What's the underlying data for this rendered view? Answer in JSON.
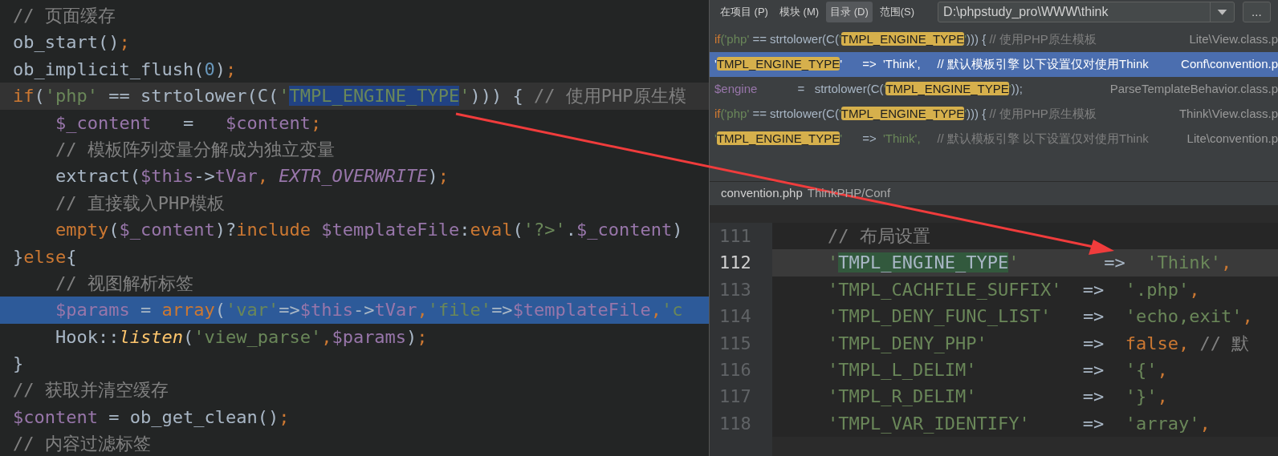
{
  "editor": {
    "lines": [
      {
        "caret_line": false,
        "selected": false,
        "tokens": [
          {
            "kind": "comment",
            "text": "// 页面缓存"
          }
        ]
      },
      {
        "caret_line": false,
        "selected": false,
        "tokens": [
          {
            "kind": "plain",
            "text": "ob_start()"
          },
          {
            "kind": "keyword",
            "text": ";"
          }
        ]
      },
      {
        "caret_line": false,
        "selected": false,
        "tokens": [
          {
            "kind": "plain",
            "text": "ob_implicit_flush("
          },
          {
            "kind": "number",
            "text": "0"
          },
          {
            "kind": "plain",
            "text": ")"
          },
          {
            "kind": "keyword",
            "text": ";"
          }
        ]
      },
      {
        "caret_line": true,
        "selected": false,
        "tokens": [
          {
            "kind": "keyword",
            "text": "if"
          },
          {
            "kind": "plain",
            "text": "("
          },
          {
            "kind": "string",
            "text": "'php'"
          },
          {
            "kind": "plain",
            "text": " == strtolower(C("
          },
          {
            "kind": "string",
            "text": "'"
          },
          {
            "kind": "string-selected",
            "text": "TMPL_ENGINE_TYPE"
          },
          {
            "kind": "string",
            "text": "'"
          },
          {
            "kind": "plain",
            "text": "))) { "
          },
          {
            "kind": "comment",
            "text": "// 使用PHP原生模"
          }
        ]
      },
      {
        "caret_line": false,
        "selected": false,
        "tokens": [
          {
            "kind": "var",
            "text": "    $_content"
          },
          {
            "kind": "plain",
            "text": "   =   "
          },
          {
            "kind": "var",
            "text": "$content"
          },
          {
            "kind": "keyword",
            "text": ";"
          }
        ]
      },
      {
        "caret_line": false,
        "selected": false,
        "tokens": [
          {
            "kind": "comment",
            "text": "    // 模板阵列变量分解成为独立变量"
          }
        ]
      },
      {
        "caret_line": false,
        "selected": false,
        "tokens": [
          {
            "kind": "plain",
            "text": "    extract("
          },
          {
            "kind": "var",
            "text": "$this"
          },
          {
            "kind": "plain",
            "text": "->"
          },
          {
            "kind": "var",
            "text": "tVar"
          },
          {
            "kind": "keyword",
            "text": ", "
          },
          {
            "kind": "constant",
            "text": "EXTR_OVERWRITE"
          },
          {
            "kind": "plain",
            "text": ")"
          },
          {
            "kind": "keyword",
            "text": ";"
          }
        ]
      },
      {
        "caret_line": false,
        "selected": false,
        "tokens": [
          {
            "kind": "comment",
            "text": "    // 直接载入PHP模板"
          }
        ]
      },
      {
        "caret_line": false,
        "selected": false,
        "tokens": [
          {
            "kind": "keyword",
            "text": "    empty"
          },
          {
            "kind": "plain",
            "text": "("
          },
          {
            "kind": "var",
            "text": "$_content"
          },
          {
            "kind": "plain",
            "text": ")?"
          },
          {
            "kind": "keyword",
            "text": "include "
          },
          {
            "kind": "var",
            "text": "$templateFile"
          },
          {
            "kind": "plain",
            "text": ":"
          },
          {
            "kind": "keyword",
            "text": "eval"
          },
          {
            "kind": "plain",
            "text": "("
          },
          {
            "kind": "string",
            "text": "'?>'"
          },
          {
            "kind": "plain",
            "text": "."
          },
          {
            "kind": "var",
            "text": "$_content"
          },
          {
            "kind": "plain",
            "text": ")"
          }
        ]
      },
      {
        "caret_line": false,
        "selected": false,
        "tokens": [
          {
            "kind": "plain",
            "text": "}"
          },
          {
            "kind": "keyword",
            "text": "else"
          },
          {
            "kind": "plain",
            "text": "{"
          }
        ]
      },
      {
        "caret_line": false,
        "selected": false,
        "tokens": [
          {
            "kind": "comment",
            "text": "    // 视图解析标签"
          }
        ]
      },
      {
        "caret_line": false,
        "selected": true,
        "tokens": [
          {
            "kind": "var",
            "text": "    $params"
          },
          {
            "kind": "plain",
            "text": " = "
          },
          {
            "kind": "keyword",
            "text": "array"
          },
          {
            "kind": "plain",
            "text": "("
          },
          {
            "kind": "string",
            "text": "'var'"
          },
          {
            "kind": "plain",
            "text": "=>"
          },
          {
            "kind": "var",
            "text": "$this"
          },
          {
            "kind": "plain",
            "text": "->"
          },
          {
            "kind": "var",
            "text": "tVar"
          },
          {
            "kind": "keyword",
            "text": ","
          },
          {
            "kind": "string",
            "text": "'file'"
          },
          {
            "kind": "plain",
            "text": "=>"
          },
          {
            "kind": "var",
            "text": "$templateFile"
          },
          {
            "kind": "keyword",
            "text": ","
          },
          {
            "kind": "string",
            "text": "'c"
          }
        ]
      },
      {
        "caret_line": false,
        "selected": false,
        "tokens": [
          {
            "kind": "plain",
            "text": "    Hook::"
          },
          {
            "kind": "static",
            "text": "listen"
          },
          {
            "kind": "plain",
            "text": "("
          },
          {
            "kind": "string",
            "text": "'view_parse'"
          },
          {
            "kind": "keyword",
            "text": ","
          },
          {
            "kind": "var",
            "text": "$params"
          },
          {
            "kind": "plain",
            "text": ")"
          },
          {
            "kind": "keyword",
            "text": ";"
          }
        ]
      },
      {
        "caret_line": false,
        "selected": false,
        "tokens": [
          {
            "kind": "plain",
            "text": "}"
          }
        ]
      },
      {
        "caret_line": false,
        "selected": false,
        "tokens": [
          {
            "kind": "comment",
            "text": "// 获取并清空缓存"
          }
        ]
      },
      {
        "caret_line": false,
        "selected": false,
        "tokens": [
          {
            "kind": "var",
            "text": "$content"
          },
          {
            "kind": "plain",
            "text": " = ob_get_clean()"
          },
          {
            "kind": "keyword",
            "text": ";"
          }
        ]
      },
      {
        "caret_line": false,
        "selected": false,
        "tokens": [
          {
            "kind": "comment",
            "text": "// 内容过滤标签"
          }
        ]
      }
    ]
  },
  "find_popup": {
    "scopes": [
      {
        "label": "在项目 (P)",
        "selected": false
      },
      {
        "label": "模块 (M)",
        "selected": false
      },
      {
        "label": "目录 (D)",
        "selected": true
      },
      {
        "label": "范围(S)",
        "selected": false
      }
    ],
    "directory": {
      "value": "D:\\phpstudy_pro\\WWW\\think"
    },
    "browse_button": "...",
    "results": [
      {
        "selected": false,
        "segments": [
          {
            "kind": "keyword",
            "text": "if"
          },
          {
            "kind": "string",
            "text": "('php'"
          },
          {
            "kind": "plain",
            "text": " == strtolower(C("
          },
          {
            "kind": "string",
            "text": "'"
          },
          {
            "kind": "match",
            "text": "TMPL_ENGINE_TYPE"
          },
          {
            "kind": "string",
            "text": "'"
          },
          {
            "kind": "plain",
            "text": "))) { "
          },
          {
            "kind": "comment",
            "text": "// 使用PHP原生模板"
          }
        ],
        "file": "Lite\\View.class.p"
      },
      {
        "selected": true,
        "segments": [
          {
            "kind": "string",
            "text": "'"
          },
          {
            "kind": "match",
            "text": "TMPL_ENGINE_TYPE"
          },
          {
            "kind": "string",
            "text": "'"
          },
          {
            "kind": "plain",
            "text": "      =>  "
          },
          {
            "kind": "string",
            "text": "'Think',"
          },
          {
            "kind": "comment",
            "text": "     // 默认模板引擎 以下设置仅对使用Think"
          }
        ],
        "file": "Conf\\convention.p"
      },
      {
        "selected": false,
        "segments": [
          {
            "kind": "var",
            "text": "$engine"
          },
          {
            "kind": "plain",
            "text": "            =   strtolower(C("
          },
          {
            "kind": "string",
            "text": "'"
          },
          {
            "kind": "match",
            "text": "TMPL_ENGINE_TYPE"
          },
          {
            "kind": "string",
            "text": "'"
          },
          {
            "kind": "plain",
            "text": "));"
          }
        ],
        "file": "ParseTemplateBehavior.class.p"
      },
      {
        "selected": false,
        "segments": [
          {
            "kind": "keyword",
            "text": "if"
          },
          {
            "kind": "string",
            "text": "('php'"
          },
          {
            "kind": "plain",
            "text": " == strtolower(C("
          },
          {
            "kind": "string",
            "text": "'"
          },
          {
            "kind": "match",
            "text": "TMPL_ENGINE_TYPE"
          },
          {
            "kind": "string",
            "text": "'"
          },
          {
            "kind": "plain",
            "text": "))) { "
          },
          {
            "kind": "comment",
            "text": "// 使用PHP原生模板"
          }
        ],
        "file": "Think\\View.class.p"
      },
      {
        "selected": false,
        "segments": [
          {
            "kind": "string",
            "text": "'"
          },
          {
            "kind": "match",
            "text": "TMPL_ENGINE_TYPE"
          },
          {
            "kind": "string",
            "text": "'"
          },
          {
            "kind": "plain",
            "text": "      =>  "
          },
          {
            "kind": "string",
            "text": "'Think',"
          },
          {
            "kind": "comment",
            "text": "     // 默认模板引擎 以下设置仅对使用Think"
          }
        ],
        "file": "Lite\\convention.p"
      }
    ],
    "preview": {
      "file_name": "convention.php",
      "file_path": "ThinkPHP/Conf",
      "lines": [
        {
          "number": "111",
          "current": false,
          "tokens": [
            {
              "kind": "comment",
              "text": "    // 布局设置"
            }
          ]
        },
        {
          "number": "112",
          "current": true,
          "tokens": [
            {
              "kind": "string",
              "text": "    '"
            },
            {
              "kind": "match",
              "text": "TMPL_ENGINE_TYPE"
            },
            {
              "kind": "string",
              "text": "'"
            },
            {
              "kind": "plain",
              "text": "        =>  "
            },
            {
              "kind": "string",
              "text": "'Think'"
            },
            {
              "kind": "keyword",
              "text": ","
            }
          ]
        },
        {
          "number": "113",
          "current": false,
          "tokens": [
            {
              "kind": "string",
              "text": "    'TMPL_CACHFILE_SUFFIX'"
            },
            {
              "kind": "plain",
              "text": "  =>  "
            },
            {
              "kind": "string",
              "text": "'.php'"
            },
            {
              "kind": "keyword",
              "text": ","
            }
          ]
        },
        {
          "number": "114",
          "current": false,
          "tokens": [
            {
              "kind": "string",
              "text": "    'TMPL_DENY_FUNC_LIST'"
            },
            {
              "kind": "plain",
              "text": "   =>  "
            },
            {
              "kind": "string",
              "text": "'echo,exit'"
            },
            {
              "kind": "keyword",
              "text": ","
            }
          ]
        },
        {
          "number": "115",
          "current": false,
          "tokens": [
            {
              "kind": "string",
              "text": "    'TMPL_DENY_PHP'"
            },
            {
              "kind": "plain",
              "text": "         =>  "
            },
            {
              "kind": "keyword",
              "text": "false, "
            },
            {
              "kind": "comment",
              "text": "// 默"
            }
          ]
        },
        {
          "number": "116",
          "current": false,
          "tokens": [
            {
              "kind": "string",
              "text": "    'TMPL_L_DELIM'"
            },
            {
              "kind": "plain",
              "text": "          =>  "
            },
            {
              "kind": "string",
              "text": "'{'"
            },
            {
              "kind": "keyword",
              "text": ","
            }
          ]
        },
        {
          "number": "117",
          "current": false,
          "tokens": [
            {
              "kind": "string",
              "text": "    'TMPL_R_DELIM'"
            },
            {
              "kind": "plain",
              "text": "          =>  "
            },
            {
              "kind": "string",
              "text": "'}'"
            },
            {
              "kind": "keyword",
              "text": ","
            }
          ]
        },
        {
          "number": "118",
          "current": false,
          "tokens": [
            {
              "kind": "string",
              "text": "    'TMPL_VAR_IDENTIFY'"
            },
            {
              "kind": "plain",
              "text": "     =>  "
            },
            {
              "kind": "string",
              "text": "'array'"
            },
            {
              "kind": "keyword",
              "text": ","
            }
          ]
        }
      ]
    }
  }
}
